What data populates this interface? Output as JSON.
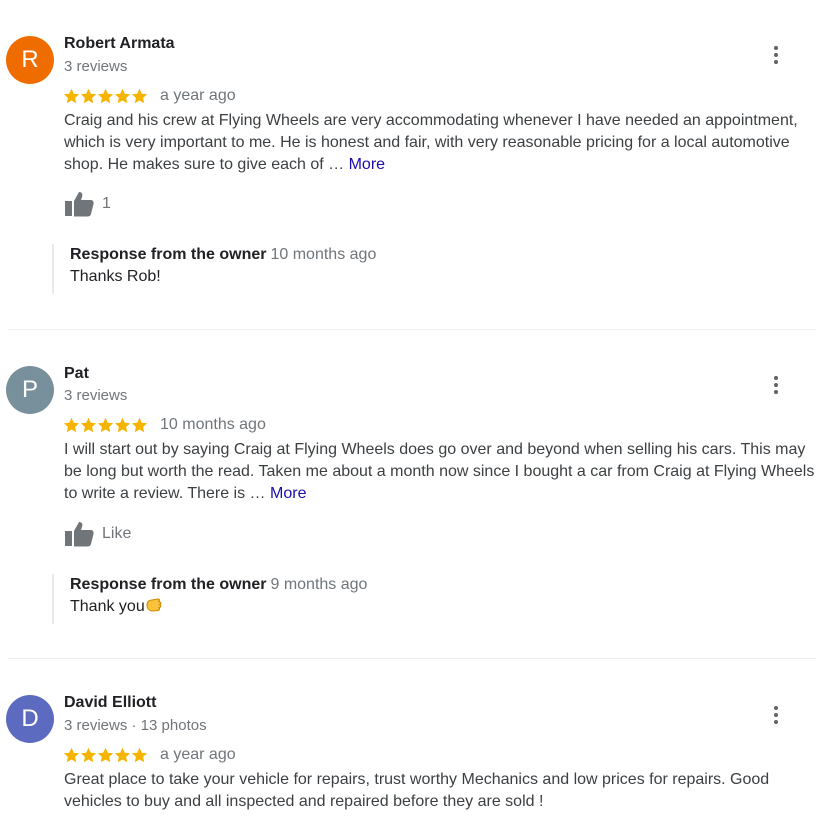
{
  "colors": {
    "star": "#f4b400",
    "link": "#1a0dab"
  },
  "icons": {
    "star": "star-icon",
    "thumb": "thumbs-up-icon",
    "menu": "more-vert-icon"
  },
  "reviews": [
    {
      "initial": "R",
      "avatar_color": "#ef6c00",
      "name": "Robert Armata",
      "meta": "3 reviews",
      "rating": 5,
      "date": "a year ago",
      "text": "Craig and his crew at Flying Wheels are very accommodating whenever I have needed an appointment, which is very important to me. He is honest and fair, with very reasonable pricing for a local automotive shop. He makes sure to give each of …",
      "more": "More",
      "like_label": "1",
      "owner_label": "Response from the owner",
      "owner_date": "10 months ago",
      "owner_text": "Thanks Rob!"
    },
    {
      "initial": "P",
      "avatar_color": "#78909c",
      "name": "Pat",
      "meta": "3 reviews",
      "rating": 5,
      "date": "10 months ago",
      "text": "I will start out by saying Craig at Flying Wheels does go over and beyond when selling his cars. This may be long but worth the read. Taken me about a month now since I bought a car from Craig at Flying Wheels to write a review. There is …",
      "more": "More",
      "like_label": "Like",
      "owner_label": "Response from the owner",
      "owner_date": "9 months ago",
      "owner_text": "Thank you"
    },
    {
      "initial": "D",
      "avatar_color": "#5c6bc0",
      "name": "David Elliott",
      "meta": "3 reviews · 13 photos",
      "rating": 5,
      "date": "a year ago",
      "text": "Great place to take your vehicle for repairs, trust worthy Mechanics and low prices for repairs. Good vehicles to buy and all inspected and repaired before they are sold !"
    }
  ]
}
